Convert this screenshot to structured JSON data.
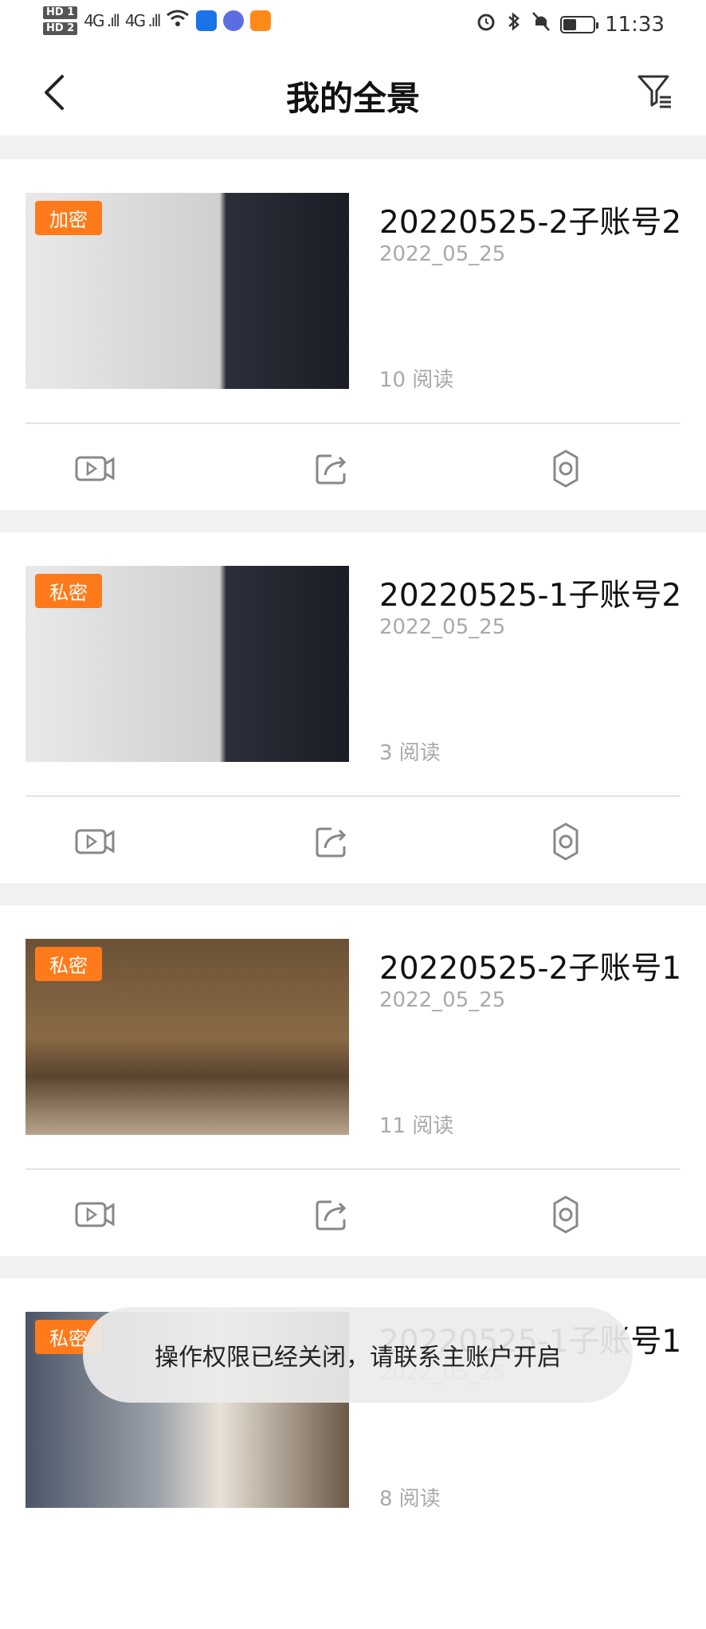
{
  "status_bar": {
    "hd1": "HD 1",
    "hd2": "HD 2",
    "net1": "4G .ıll",
    "net2": "4G .ıll",
    "time": "11:33",
    "battery_percent": 45
  },
  "header": {
    "title": "我的全景"
  },
  "cards": [
    {
      "badge": "加密",
      "title": "20220525-2子账号2",
      "date": "2022_05_25",
      "reads": "10 阅读"
    },
    {
      "badge": "私密",
      "title": "20220525-1子账号2",
      "date": "2022_05_25",
      "reads": "3 阅读"
    },
    {
      "badge": "私密",
      "title": "20220525-2子账号1",
      "date": "2022_05_25",
      "reads": "11 阅读"
    },
    {
      "badge": "私密",
      "title": "20220525-1子账号1",
      "date": "2022_05_25",
      "reads": "8 阅读"
    }
  ],
  "actions": [
    "video-icon",
    "share-icon",
    "settings-icon"
  ],
  "toast": {
    "message": "操作权限已经关闭，请联系主账户开启"
  },
  "colors": {
    "badge": "#ff7a1a",
    "muted_text": "#a9a9a9",
    "page_bg": "#f1f1f1"
  }
}
